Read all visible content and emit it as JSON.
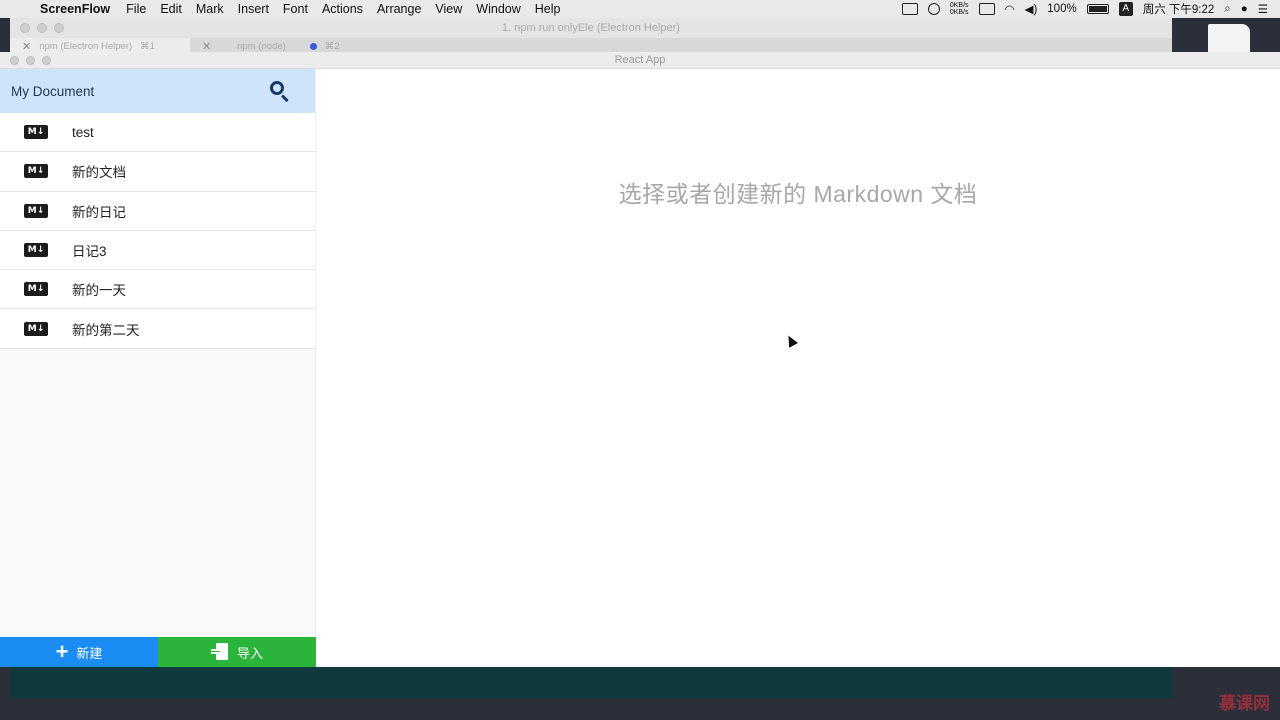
{
  "menubar": {
    "app_name": "ScreenFlow",
    "items": [
      "File",
      "Edit",
      "Mark",
      "Insert",
      "Font",
      "Actions",
      "Arrange",
      "View",
      "Window",
      "Help"
    ],
    "net_up": "0KB/s",
    "net_down": "0KB/s",
    "battery": "100%",
    "ime": "A",
    "clock": "周六 下午9:22"
  },
  "terminal": {
    "title": "1. npm run onlyEle (Electron Helper)",
    "tabs": [
      {
        "label": "npm (Electron Helper)",
        "shortcut": "⌘1"
      },
      {
        "label": "npm (node)",
        "shortcut": ""
      },
      {
        "label": "",
        "shortcut": "⌘2"
      }
    ]
  },
  "app": {
    "title": "React App",
    "sidebar": {
      "title": "My Document",
      "files": [
        {
          "name": "test",
          "icon": "M↓"
        },
        {
          "name": "新的文档",
          "icon": "M↓"
        },
        {
          "name": "新的日记",
          "icon": "M↓"
        },
        {
          "name": "日记3",
          "icon": "M↓"
        },
        {
          "name": "新的一天",
          "icon": "M↓"
        },
        {
          "name": "新的第二天",
          "icon": "M↓"
        }
      ],
      "new_label": "新建",
      "import_label": "导入"
    },
    "main": {
      "placeholder": "选择或者创建新的 Markdown 文档"
    }
  },
  "watermark": "慕课网",
  "colors": {
    "search_bar_bg": "#cfe3fb",
    "new_button": "#1b8cf2",
    "import_button": "#2ab43c",
    "terminal_bg": "#0f3a3d"
  }
}
